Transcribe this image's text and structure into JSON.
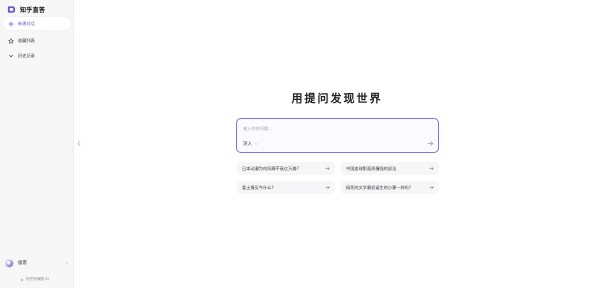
{
  "brand": {
    "name": "知乎直答",
    "icon": "zhida-logo-icon",
    "accent": "#6b4fd8"
  },
  "sidebar": {
    "items": [
      {
        "label": "新建对话",
        "icon": "plus-icon",
        "active": true
      },
      {
        "label": "收藏列表",
        "icon": "star-icon",
        "active": false
      },
      {
        "label": "历史记录",
        "icon": "chevron-down-icon",
        "active": false
      }
    ],
    "user": {
      "name": "极客",
      "icon": "chevron-right-icon"
    },
    "footer": "知乎知海图 AI"
  },
  "main": {
    "title": "用提问发现世界",
    "input": {
      "placeholder": "输入你的问题...",
      "value": ""
    },
    "mode": "深入",
    "suggestions": [
      "日本动漫为何风靡不衰亿万美?",
      "中国皮球影面再撞强的说法",
      "爱土情见今什么?",
      "搞死的文学最初诞生的小骤一样吗?"
    ]
  }
}
